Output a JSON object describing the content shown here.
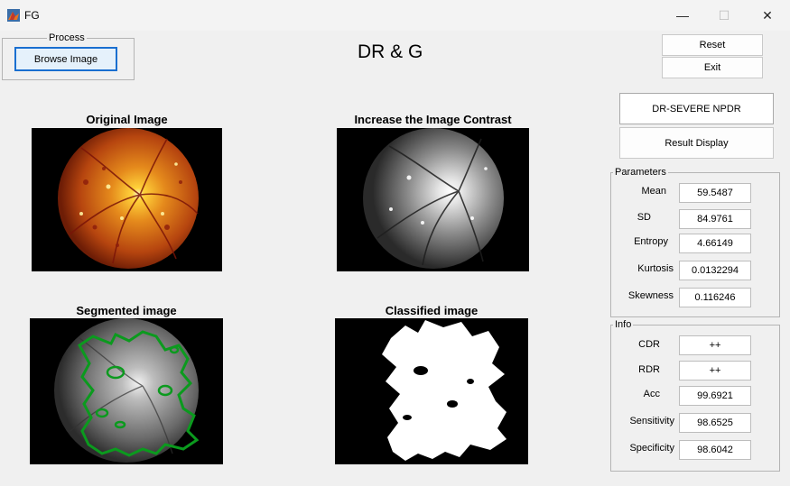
{
  "window": {
    "title": "FG",
    "minimize": "—",
    "maximize": "☐",
    "close": "✕"
  },
  "process": {
    "title": "Process",
    "browse_label": "Browse Image"
  },
  "heading": "DR & G",
  "controls": {
    "reset_label": "Reset",
    "exit_label": "Exit"
  },
  "result": {
    "diagnosis": "DR-SEVERE NPDR",
    "display_label": "Result Display"
  },
  "images": {
    "original": "Original Image",
    "contrast": "Increase the Image Contrast",
    "segmented": "Segmented image",
    "classified": "Classified image"
  },
  "parameters": {
    "title": "Parameters",
    "items": [
      {
        "label": "Mean",
        "value": "59.5487"
      },
      {
        "label": "SD",
        "value": "84.9761"
      },
      {
        "label": "Entropy",
        "value": "4.66149"
      },
      {
        "label": "Kurtosis",
        "value": "0.0132294"
      },
      {
        "label": "Skewness",
        "value": "0.116246"
      }
    ]
  },
  "info": {
    "title": "Info",
    "items": [
      {
        "label": "CDR",
        "value": "++"
      },
      {
        "label": "RDR",
        "value": "++"
      },
      {
        "label": "Acc",
        "value": "99.6921"
      },
      {
        "label": "Sensitivity",
        "value": "98.6525"
      },
      {
        "label": "Specificity",
        "value": "98.6042"
      }
    ]
  }
}
